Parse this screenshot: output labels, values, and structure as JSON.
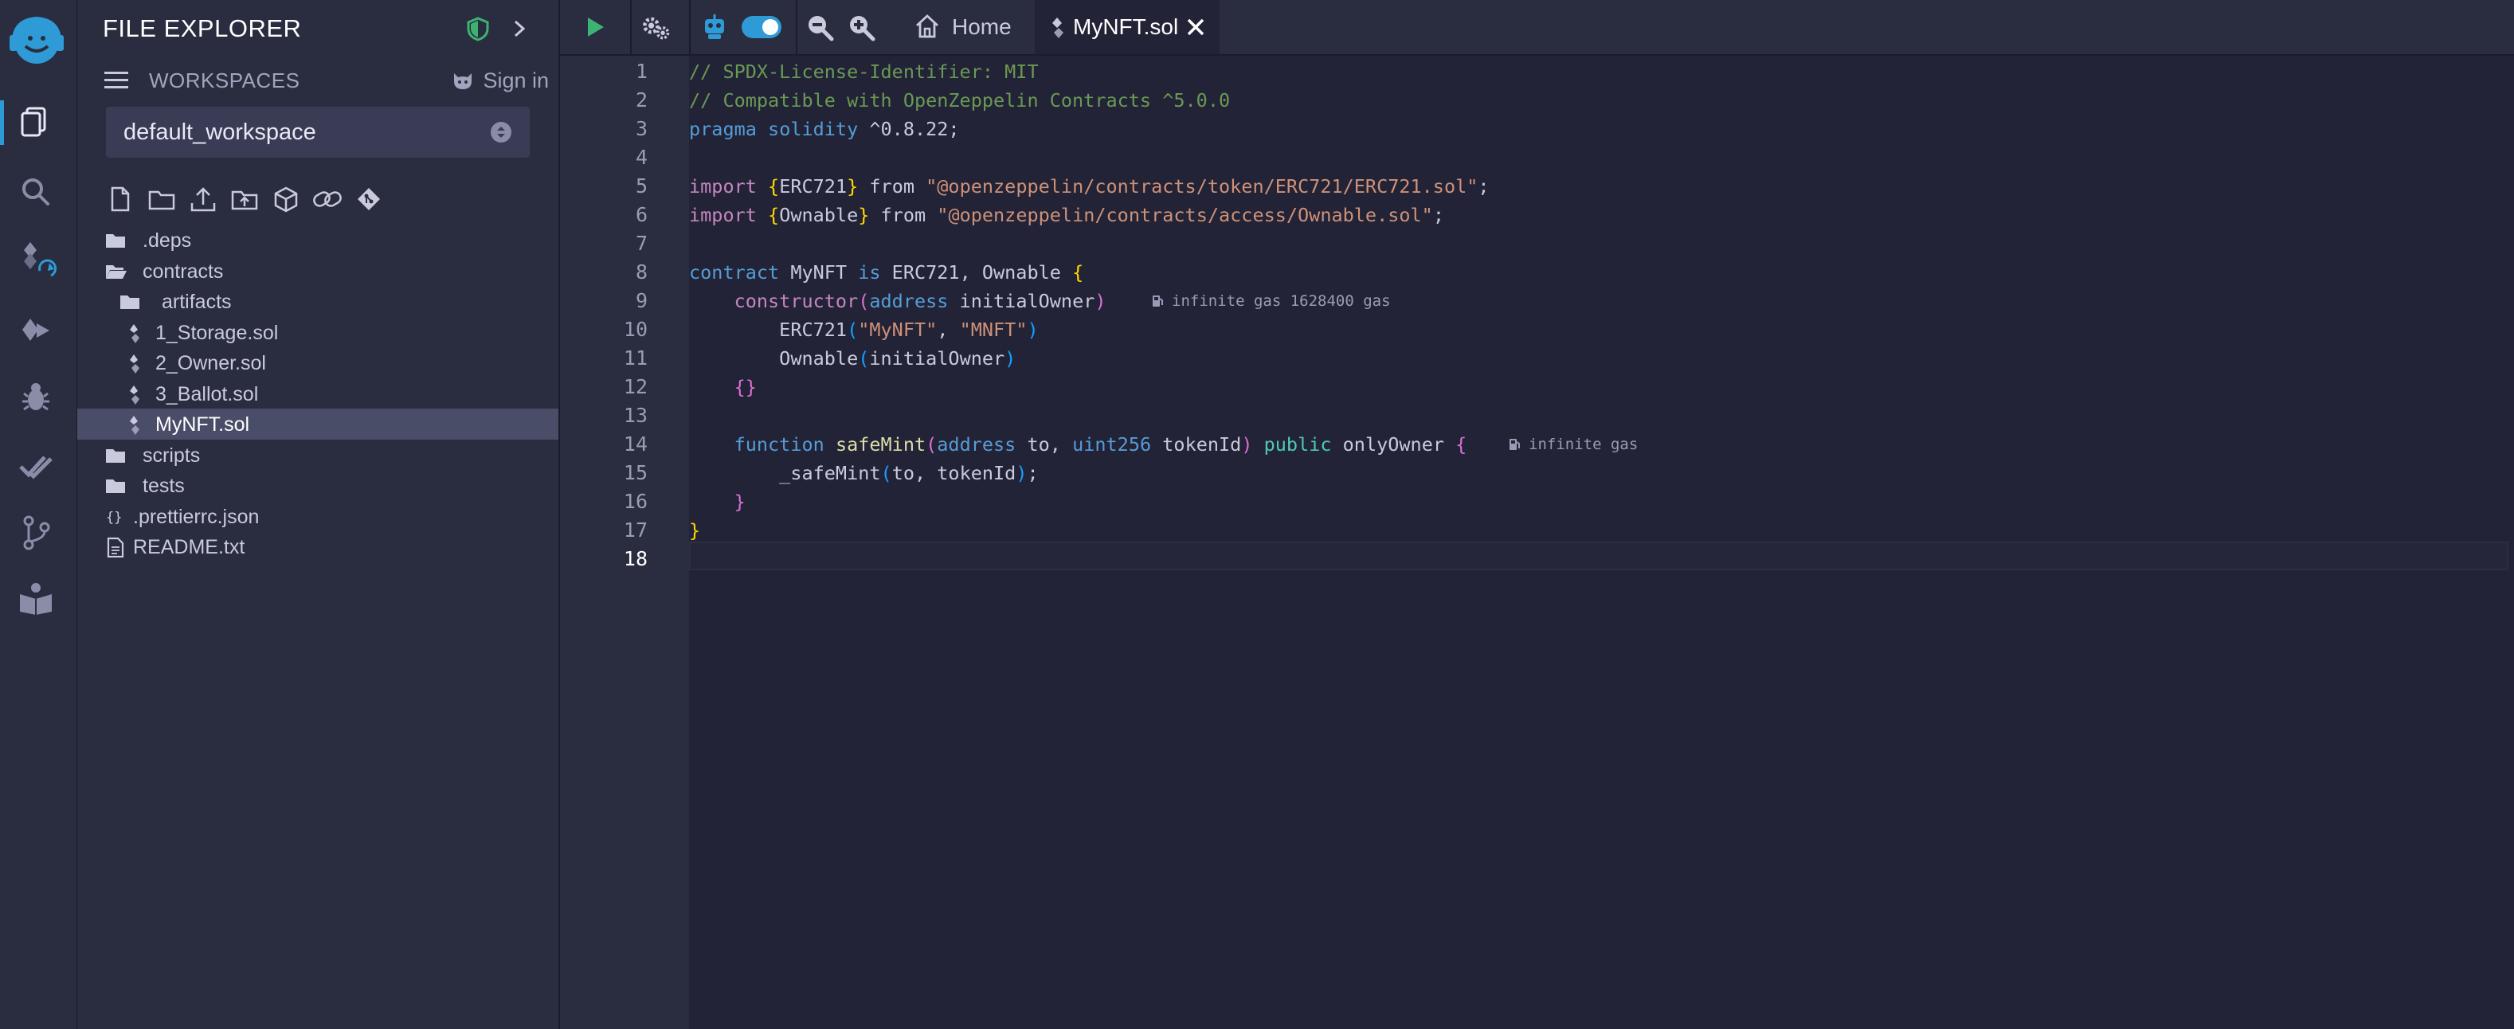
{
  "panel": {
    "title": "FILE EXPLORER",
    "workspaces_label": "WORKSPACES",
    "signin_label": "Sign in",
    "workspace_selected": "default_workspace"
  },
  "tree": [
    {
      "label": ".deps",
      "icon": "folder-icon",
      "depth": 0
    },
    {
      "label": "contracts",
      "icon": "folder-open-icon",
      "depth": 0
    },
    {
      "label": "artifacts",
      "icon": "folder-icon",
      "depth": 1
    },
    {
      "label": "1_Storage.sol",
      "icon": "solidity-file-icon",
      "depth": 1
    },
    {
      "label": "2_Owner.sol",
      "icon": "solidity-file-icon",
      "depth": 1
    },
    {
      "label": "3_Ballot.sol",
      "icon": "solidity-file-icon",
      "depth": 1
    },
    {
      "label": "MyNFT.sol",
      "icon": "solidity-file-icon",
      "depth": 1,
      "selected": true
    },
    {
      "label": "scripts",
      "icon": "folder-icon",
      "depth": 0
    },
    {
      "label": "tests",
      "icon": "folder-icon",
      "depth": 0
    },
    {
      "label": ".prettierrc.json",
      "icon": "json-file-icon",
      "depth": 0
    },
    {
      "label": "README.txt",
      "icon": "text-file-icon",
      "depth": 0
    }
  ],
  "tabs": {
    "home_label": "Home",
    "file_label": "MyNFT.sol"
  },
  "editor": {
    "active_line": 18,
    "line_numbers": [
      "1",
      "2",
      "3",
      "4",
      "5",
      "6",
      "7",
      "8",
      "9",
      "10",
      "11",
      "12",
      "13",
      "14",
      "15",
      "16",
      "17",
      "18"
    ],
    "gas_hints": {
      "line9": "infinite gas 1628400 gas",
      "line14": "infinite gas"
    },
    "lines": [
      [
        [
          "c-com",
          "// SPDX-License-Identifier: MIT"
        ]
      ],
      [
        [
          "c-com",
          "// Compatible with OpenZeppelin Contracts ^5.0.0"
        ]
      ],
      [
        [
          "c-kw",
          "pragma"
        ],
        [
          "c-def",
          " "
        ],
        [
          "c-kw",
          "solidity"
        ],
        [
          "c-def",
          " ^0.8.22;"
        ]
      ],
      [],
      [
        [
          "c-ctrl",
          "import"
        ],
        [
          "c-def",
          " "
        ],
        [
          "c-br1",
          "{"
        ],
        [
          "c-def",
          "ERC721"
        ],
        [
          "c-br1",
          "}"
        ],
        [
          "c-def",
          " from "
        ],
        [
          "c-str",
          "\"@openzeppelin/contracts/token/ERC721/ERC721.sol\""
        ],
        [
          "c-def",
          ";"
        ]
      ],
      [
        [
          "c-ctrl",
          "import"
        ],
        [
          "c-def",
          " "
        ],
        [
          "c-br1",
          "{"
        ],
        [
          "c-def",
          "Ownable"
        ],
        [
          "c-br1",
          "}"
        ],
        [
          "c-def",
          " from "
        ],
        [
          "c-str",
          "\"@openzeppelin/contracts/access/Ownable.sol\""
        ],
        [
          "c-def",
          ";"
        ]
      ],
      [],
      [
        [
          "c-kw",
          "contract"
        ],
        [
          "c-def",
          " MyNFT "
        ],
        [
          "c-kw",
          "is"
        ],
        [
          "c-def",
          " ERC721, Ownable "
        ],
        [
          "c-br1",
          "{"
        ]
      ],
      [
        [
          "c-def",
          "    "
        ],
        [
          "c-ctrl",
          "constructor"
        ],
        [
          "c-br2",
          "("
        ],
        [
          "c-kw",
          "address"
        ],
        [
          "c-def",
          " initialOwner"
        ],
        [
          "c-br2",
          ")"
        ]
      ],
      [
        [
          "c-def",
          "        ERC721"
        ],
        [
          "c-br3",
          "("
        ],
        [
          "c-str",
          "\"MyNFT\""
        ],
        [
          "c-def",
          ", "
        ],
        [
          "c-str",
          "\"MNFT\""
        ],
        [
          "c-br3",
          ")"
        ]
      ],
      [
        [
          "c-def",
          "        Ownable"
        ],
        [
          "c-br3",
          "("
        ],
        [
          "c-def",
          "initialOwner"
        ],
        [
          "c-br3",
          ")"
        ]
      ],
      [
        [
          "c-def",
          "    "
        ],
        [
          "c-br2",
          "{}"
        ]
      ],
      [],
      [
        [
          "c-def",
          "    "
        ],
        [
          "c-kw",
          "function"
        ],
        [
          "c-def",
          " "
        ],
        [
          "c-fn",
          "safeMint"
        ],
        [
          "c-br2",
          "("
        ],
        [
          "c-kw",
          "address"
        ],
        [
          "c-def",
          " to, "
        ],
        [
          "c-kw",
          "uint256"
        ],
        [
          "c-def",
          " tokenId"
        ],
        [
          "c-br2",
          ")"
        ],
        [
          "c-def",
          " "
        ],
        [
          "c-mod",
          "public"
        ],
        [
          "c-def",
          " onlyOwner "
        ],
        [
          "c-br2",
          "{"
        ]
      ],
      [
        [
          "c-def",
          "        _safeMint"
        ],
        [
          "c-br3",
          "("
        ],
        [
          "c-def",
          "to, tokenId"
        ],
        [
          "c-br3",
          ")"
        ],
        [
          "c-def",
          ";"
        ]
      ],
      [
        [
          "c-def",
          "    "
        ],
        [
          "c-br2",
          "}"
        ]
      ],
      [
        [
          "c-br1",
          "}"
        ]
      ],
      []
    ]
  },
  "colors": {
    "accent": "#2e9bd6",
    "run_green": "#3eb371",
    "shield_green": "#3eb371",
    "background": "#222336",
    "panel": "#2a2c3f"
  }
}
